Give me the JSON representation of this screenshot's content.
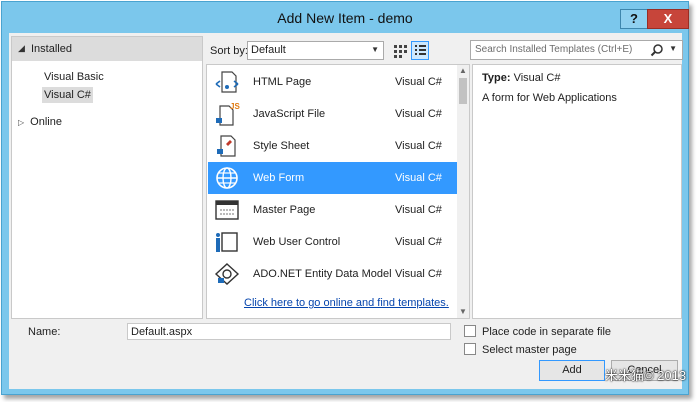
{
  "window": {
    "title": "Add New Item - demo",
    "help_label": "?",
    "close_label": "X"
  },
  "left_panel": {
    "installed_label": "Installed",
    "items": [
      {
        "label": "Visual Basic",
        "selected": false
      },
      {
        "label": "Visual C#",
        "selected": true
      }
    ],
    "online_label": "Online"
  },
  "toolbar": {
    "sort_label": "Sort by:",
    "sort_value": "Default",
    "search_placeholder": "Search Installed Templates (Ctrl+E)"
  },
  "templates": [
    {
      "name": "HTML Page",
      "lang": "Visual C#",
      "icon": "html-page-icon",
      "selected": false
    },
    {
      "name": "JavaScript File",
      "lang": "Visual C#",
      "icon": "javascript-file-icon",
      "selected": false
    },
    {
      "name": "Style Sheet",
      "lang": "Visual C#",
      "icon": "style-sheet-icon",
      "selected": false
    },
    {
      "name": "Web Form",
      "lang": "Visual C#",
      "icon": "web-form-icon",
      "selected": true
    },
    {
      "name": "Master Page",
      "lang": "Visual C#",
      "icon": "master-page-icon",
      "selected": false
    },
    {
      "name": "Web User Control",
      "lang": "Visual C#",
      "icon": "web-user-control-icon",
      "selected": false
    },
    {
      "name": "ADO.NET Entity Data Model",
      "lang": "Visual C#",
      "icon": "entity-data-model-icon",
      "selected": false
    }
  ],
  "online_link": "Click here to go online and find templates.",
  "details": {
    "type_label": "Type:",
    "type_value": "Visual C#",
    "description": "A form for Web Applications"
  },
  "bottom": {
    "name_label": "Name:",
    "name_value": "Default.aspx",
    "place_code_label": "Place code in separate file",
    "select_master_label": "Select master page",
    "add_label": "Add",
    "cancel_label": "Cancel"
  },
  "watermark": "米米猫© 2013",
  "colors": {
    "accent": "#3399ff",
    "titlebar": "#7bc7ec",
    "close": "#c7453a",
    "link": "#0645ad"
  }
}
